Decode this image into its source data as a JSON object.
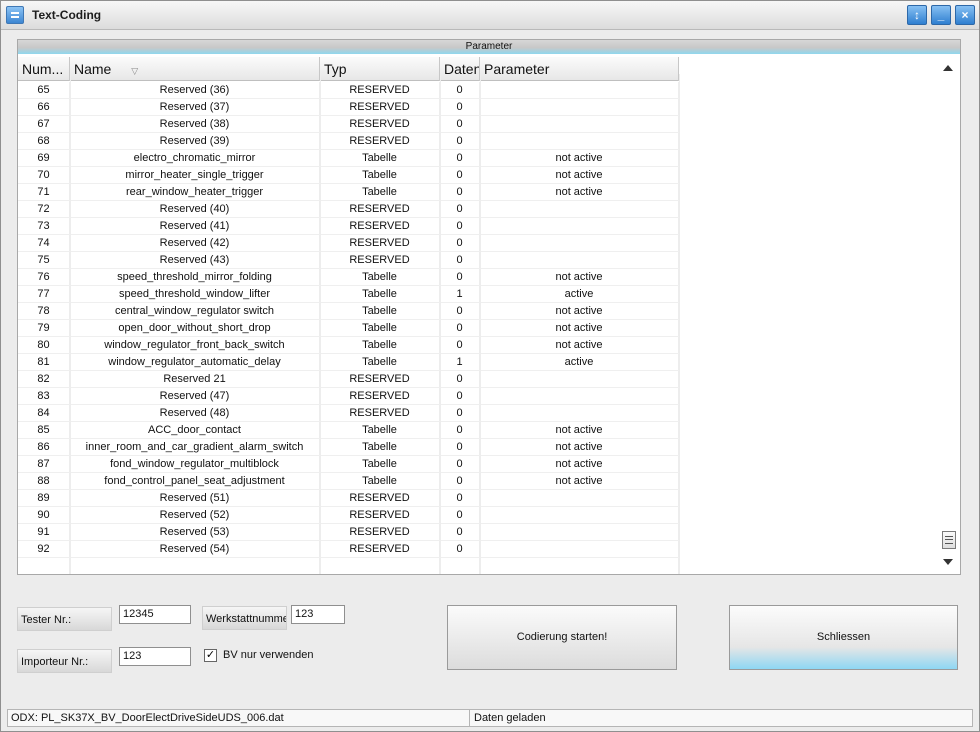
{
  "window": {
    "title": "Text-Coding",
    "icon": "app-window-icon"
  },
  "panel": {
    "title": "Parameter"
  },
  "table": {
    "headers": [
      "Num...",
      "Name",
      "Typ",
      "Daten",
      "Parameter"
    ],
    "rows": [
      [
        "65",
        "Reserved (36)",
        "RESERVED",
        "0",
        ""
      ],
      [
        "66",
        "Reserved (37)",
        "RESERVED",
        "0",
        ""
      ],
      [
        "67",
        "Reserved (38)",
        "RESERVED",
        "0",
        ""
      ],
      [
        "68",
        "Reserved (39)",
        "RESERVED",
        "0",
        ""
      ],
      [
        "69",
        "electro_chromatic_mirror",
        "Tabelle",
        "0",
        "not active"
      ],
      [
        "70",
        "mirror_heater_single_trigger",
        "Tabelle",
        "0",
        "not active"
      ],
      [
        "71",
        "rear_window_heater_trigger",
        "Tabelle",
        "0",
        "not active"
      ],
      [
        "72",
        "Reserved (40)",
        "RESERVED",
        "0",
        ""
      ],
      [
        "73",
        "Reserved (41)",
        "RESERVED",
        "0",
        ""
      ],
      [
        "74",
        "Reserved (42)",
        "RESERVED",
        "0",
        ""
      ],
      [
        "75",
        "Reserved (43)",
        "RESERVED",
        "0",
        ""
      ],
      [
        "76",
        "speed_threshold_mirror_folding",
        "Tabelle",
        "0",
        "not active"
      ],
      [
        "77",
        "speed_threshold_window_lifter",
        "Tabelle",
        "1",
        "active"
      ],
      [
        "78",
        "central_window_regulator switch",
        "Tabelle",
        "0",
        "not active"
      ],
      [
        "79",
        "open_door_without_short_drop",
        "Tabelle",
        "0",
        "not active"
      ],
      [
        "80",
        "window_regulator_front_back_switch",
        "Tabelle",
        "0",
        "not active"
      ],
      [
        "81",
        "window_regulator_automatic_delay",
        "Tabelle",
        "1",
        "active"
      ],
      [
        "82",
        "Reserved 21",
        "RESERVED",
        "0",
        ""
      ],
      [
        "83",
        "Reserved (47)",
        "RESERVED",
        "0",
        ""
      ],
      [
        "84",
        "Reserved (48)",
        "RESERVED",
        "0",
        ""
      ],
      [
        "85",
        "ACC_door_contact",
        "Tabelle",
        "0",
        "not active"
      ],
      [
        "86",
        "inner_room_and_car_gradient_alarm_switch",
        "Tabelle",
        "0",
        "not active"
      ],
      [
        "87",
        "fond_window_regulator_multiblock",
        "Tabelle",
        "0",
        "not active"
      ],
      [
        "88",
        "fond_control_panel_seat_adjustment",
        "Tabelle",
        "0",
        "not active"
      ],
      [
        "89",
        "Reserved (51)",
        "RESERVED",
        "0",
        ""
      ],
      [
        "90",
        "Reserved (52)",
        "RESERVED",
        "0",
        ""
      ],
      [
        "91",
        "Reserved (53)",
        "RESERVED",
        "0",
        ""
      ],
      [
        "92",
        "Reserved (54)",
        "RESERVED",
        "0",
        ""
      ],
      [
        "",
        "",
        "",
        "",
        ""
      ]
    ]
  },
  "form": {
    "tester_label": "Tester Nr.:",
    "tester_value": "12345",
    "werkstatt_label": "Werkstattnumme",
    "werkstatt_value": "123",
    "importeur_label": "Importeur Nr.:",
    "importeur_value": "123",
    "bv_label": "BV nur verwenden",
    "bv_checked": true
  },
  "buttons": {
    "start_label": "Codierung starten!",
    "close_label": "Schliessen"
  },
  "status": {
    "left": "ODX: PL_SK37X_BV_DoorElectDriveSideUDS_006.dat",
    "right": "Daten geladen"
  },
  "colors": {
    "accent": "#2f7fd0",
    "button_glow": "#8ed7f3"
  }
}
